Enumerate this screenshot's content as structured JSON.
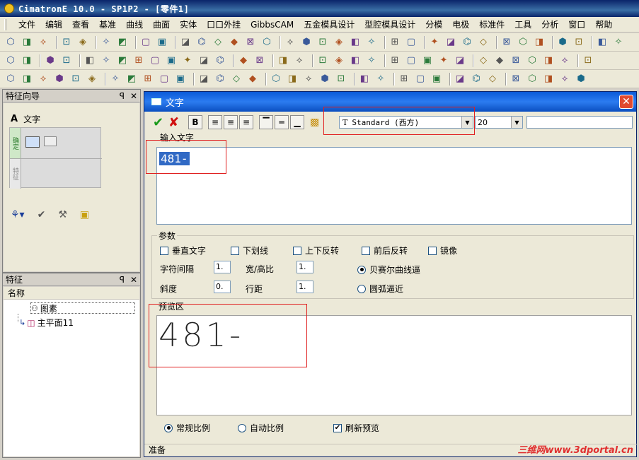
{
  "window": {
    "title": "CimatronE 10.0 - SP1P2 - [零件1]"
  },
  "menu": [
    "文件",
    "编辑",
    "查看",
    "基准",
    "曲线",
    "曲面",
    "实体",
    "口口外挂",
    "GibbsCAM",
    "五金模具设计",
    "型腔模具设计",
    "分模",
    "电极",
    "标准件",
    "工具",
    "分析",
    "窗口",
    "帮助"
  ],
  "wizard_panel": {
    "title": "特征向导",
    "pin": "ꟼ",
    "close": "✕",
    "feature_label": "文字",
    "tab_top": "确定",
    "tab_bottom": "特征"
  },
  "feature_panel": {
    "title": "特征",
    "pin": "ꟼ",
    "close": "✕",
    "column_header": "名称",
    "items": [
      "图素",
      "主平面11"
    ]
  },
  "dialog": {
    "title": "文字",
    "close": "✕",
    "bold_label": "B",
    "font_value": "Standard (西方)",
    "font_prefix": "T",
    "size_value": "20",
    "input_group_label": "输入文字",
    "input_text": "481-",
    "params_label": "参数",
    "checkboxes": {
      "vertical": "垂直文字",
      "underline": "下划线",
      "flip_updown": "上下反转",
      "flip_frontback": "前后反转",
      "mirror": "镜像"
    },
    "char_spacing_label": "字符间隔",
    "char_spacing_value": "1.",
    "aspect_label": "宽/高比",
    "aspect_value": "1.",
    "slant_label": "斜度",
    "slant_value": "0.",
    "line_spacing_label": "行距",
    "line_spacing_value": "1.",
    "bezier_label": "贝赛尔曲线逼",
    "arc_label": "圆弧逼近",
    "preview_label": "预览区",
    "preview_text": "481-",
    "normal_scale_label": "常规比例",
    "auto_scale_label": "自动比例",
    "refresh_label": "刷新预览",
    "status": "准备"
  },
  "watermark": "三维网www.3dportal.cn",
  "colors": {
    "accent_red": "#e02020",
    "title_blue": "#0a246a",
    "dialog_blue": "#2c7cf0"
  }
}
